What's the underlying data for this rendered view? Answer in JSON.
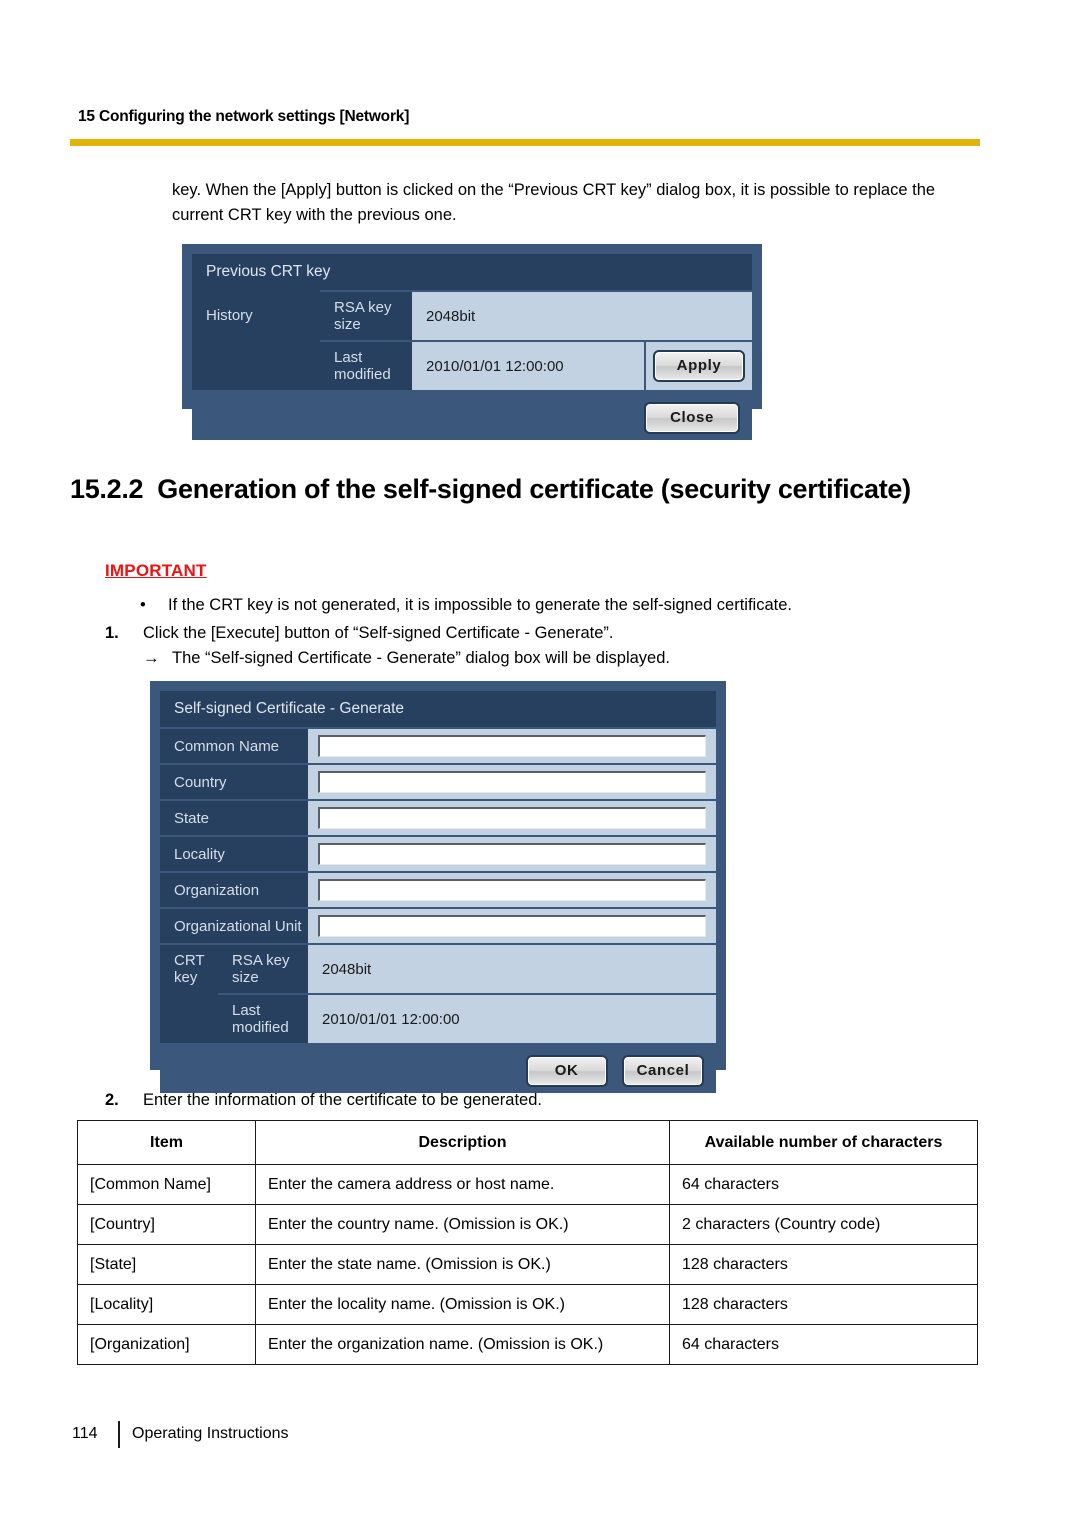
{
  "running_head": "15 Configuring the network settings [Network]",
  "accent_rule_color": "#e0b40c",
  "intro_paragraph": "key. When the [Apply] button is clicked on the “Previous CRT key” dialog box, it is possible to replace the current CRT key with the previous one.",
  "previous_crt_dialog": {
    "title": "Previous CRT key",
    "history_label": "History",
    "rsa_key_size_label": "RSA key size",
    "rsa_key_size_value": "2048bit",
    "last_modified_label": "Last modified",
    "last_modified_value": "2010/01/01 12:00:00",
    "apply_label": "Apply",
    "close_label": "Close"
  },
  "section": {
    "number": "15.2.2",
    "title": "Generation of the self-signed certificate (security certificate)"
  },
  "important": {
    "heading": "IMPORTANT",
    "heading_color": "#ee1111",
    "bullet_glyph": "•",
    "bullets": [
      "If the CRT key is not generated, it is impossible to generate the self-signed certificate."
    ]
  },
  "steps": {
    "step1_number": "1.",
    "step1_text": "Click the [Execute] button of “Self-signed Certificate - Generate”.",
    "step1_arrow_glyph": "→",
    "step1_arrow_text": "The “Self-signed Certificate - Generate” dialog box will be displayed.",
    "step2_number": "2.",
    "step2_text": "Enter the information of the certificate to be generated."
  },
  "self_signed_dialog": {
    "title": "Self-signed Certificate - Generate",
    "fields": [
      {
        "label": "Common Name",
        "value": ""
      },
      {
        "label": "Country",
        "value": ""
      },
      {
        "label": "State",
        "value": ""
      },
      {
        "label": "Locality",
        "value": ""
      },
      {
        "label": "Organization",
        "value": ""
      },
      {
        "label": "Organizational Unit",
        "value": ""
      }
    ],
    "crt_key_label": "CRT key",
    "rsa_key_size_label": "RSA key size",
    "rsa_key_size_value": "2048bit",
    "last_modified_label": "Last modified",
    "last_modified_value": "2010/01/01 12:00:00",
    "ok_label": "OK",
    "cancel_label": "Cancel"
  },
  "spec_table": {
    "headers": [
      "Item",
      "Description",
      "Available number of characters"
    ],
    "rows": [
      [
        "[Common Name]",
        "Enter the camera address or host name.",
        "64 characters"
      ],
      [
        "[Country]",
        "Enter the country name. (Omission is OK.)",
        "2 characters (Country code)"
      ],
      [
        "[State]",
        "Enter the state name. (Omission is OK.)",
        "128 characters"
      ],
      [
        "[Locality]",
        "Enter the locality name. (Omission is OK.)",
        "128 characters"
      ],
      [
        "[Organization]",
        "Enter the organization name. (Omission is OK.)",
        "64 characters"
      ]
    ]
  },
  "footer": {
    "page_number": "114",
    "document_name": "Operating Instructions"
  }
}
